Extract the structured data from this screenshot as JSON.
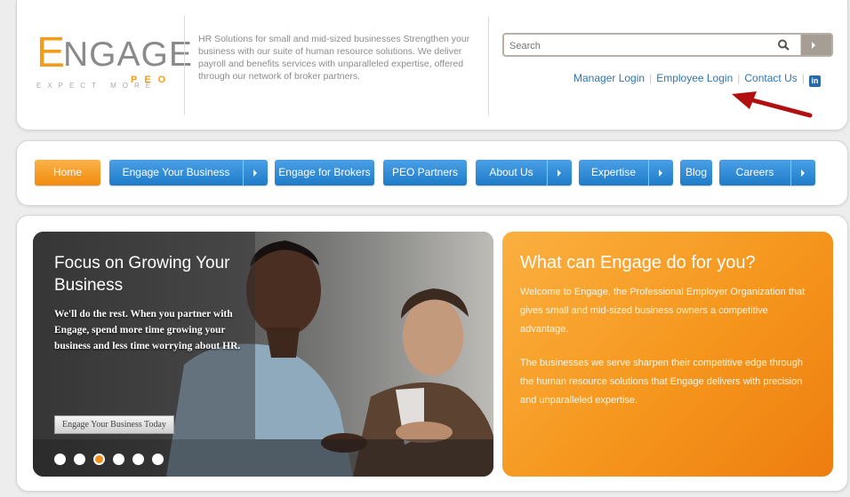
{
  "header": {
    "logo": {
      "letter": "E",
      "word": "NGAGE",
      "sub": "PEO",
      "tagline": "EXPECT MORE"
    },
    "intro": "HR Solutions for small and mid-sized businesses Strengthen your business with our suite of human resource solutions. We deliver payroll and benefits services with unparalleled expertise, offered through our network of broker partners.",
    "search": {
      "placeholder": "Search"
    },
    "links": {
      "manager": "Manager Login",
      "employee": "Employee Login",
      "contact": "Contact Us",
      "linkedin": "in"
    }
  },
  "nav": [
    {
      "label": "Home",
      "active": true
    },
    {
      "label": "Engage Your Business"
    },
    {
      "label": "Engage for Brokers"
    },
    {
      "label": "PEO Partners"
    },
    {
      "label": "About Us"
    },
    {
      "label": "Expertise"
    },
    {
      "label": "Blog"
    },
    {
      "label": "Careers"
    }
  ],
  "hero": {
    "title": "Focus on Growing Your Business",
    "body": "We'll do the rest. When you partner with Engage, spend more time growing your business and less time worrying about HR.",
    "button": "Engage Your Business Today",
    "slide_count": 6,
    "active_slide": 3
  },
  "info": {
    "title": "What can Engage do for you?",
    "p1": "Welcome to Engage, the Professional Employer Organization that gives small and mid-sized business owners a competitive advantage.",
    "p2": "The businesses we serve sharpen their competitive edge through the human resource solutions that Engage delivers with precision and unparalleled expertise."
  },
  "colors": {
    "orange": "#f39c1b",
    "nav_blue": "#1f7bc9",
    "link_blue": "#2f76b1",
    "arrow_red": "#b21010"
  }
}
